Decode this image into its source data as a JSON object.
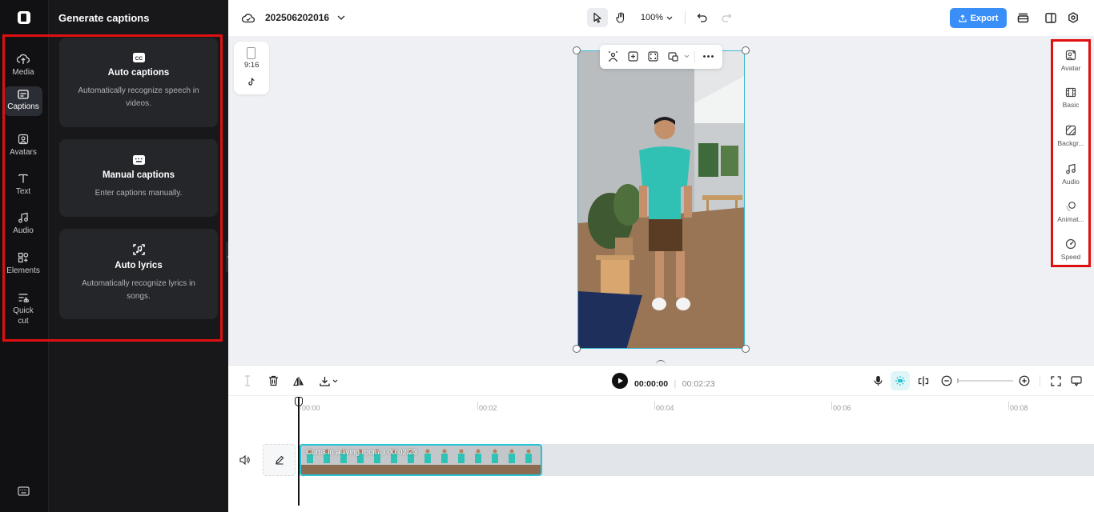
{
  "rail": {
    "items": [
      {
        "label": "Media",
        "icon": "cloud-upload-icon"
      },
      {
        "label": "Captions",
        "icon": "captions-icon"
      },
      {
        "label": "Avatars",
        "icon": "avatar-icon"
      },
      {
        "label": "Text",
        "icon": "text-icon"
      },
      {
        "label": "Audio",
        "icon": "music-note-icon"
      },
      {
        "label": "Elements",
        "icon": "elements-icon"
      },
      {
        "label": "Quick cut",
        "icon": "quick-cut-icon"
      }
    ],
    "active": "Captions"
  },
  "panel": {
    "title": "Generate captions",
    "cards": [
      {
        "title": "Auto captions",
        "desc": "Automatically recognize speech in videos.",
        "icon": "cc-icon"
      },
      {
        "title": "Manual captions",
        "desc": "Enter captions manually.",
        "icon": "keyboard-icon"
      },
      {
        "title": "Auto lyrics",
        "desc": "Automatically recognize lyrics in songs.",
        "icon": "lyrics-icon"
      }
    ]
  },
  "topbar": {
    "project_name": "202506202016",
    "zoom": "100%",
    "export_label": "Export"
  },
  "canvas": {
    "ratio": "9:16"
  },
  "right_rail": {
    "items": [
      {
        "label": "Avatar",
        "icon": "avatar-add-icon"
      },
      {
        "label": "Basic",
        "icon": "film-icon"
      },
      {
        "label": "Backgr...",
        "icon": "background-icon"
      },
      {
        "label": "Audio",
        "icon": "music-note-icon"
      },
      {
        "label": "Animat...",
        "icon": "animation-icon"
      },
      {
        "label": "Speed",
        "icon": "speed-icon"
      }
    ]
  },
  "timeline": {
    "current_time": "00:00:00",
    "total_time": "00:02:23",
    "separator": "|",
    "ticks": [
      "00:00",
      "00:02",
      "00:04",
      "00:06",
      "00:08"
    ],
    "clip_label": "Curtis  in a living room 3   00:02:23"
  },
  "colors": {
    "accent": "#3a8ef7",
    "selection": "#27c3d6",
    "highlight": "#e01010"
  }
}
